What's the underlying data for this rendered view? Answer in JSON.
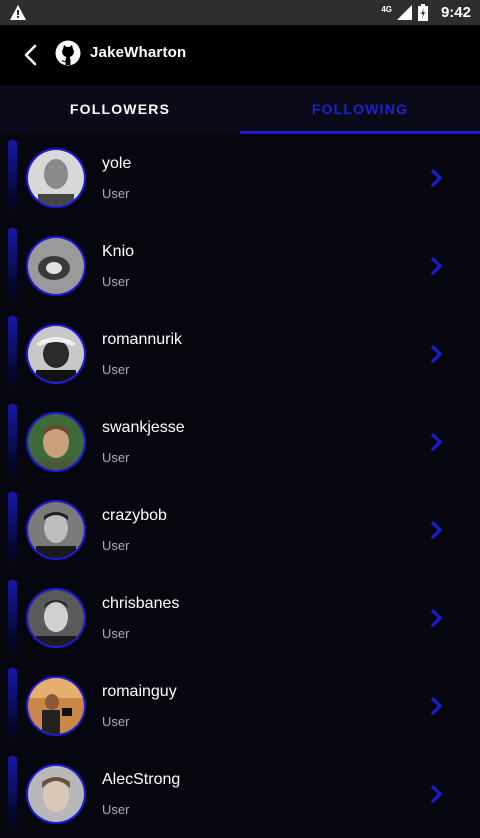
{
  "status_bar": {
    "network": "4G",
    "time": "9:42"
  },
  "toolbar": {
    "title": "JakeWharton"
  },
  "tabs": [
    {
      "label": "FOLLOWERS",
      "active": false
    },
    {
      "label": "FOLLOWING",
      "active": true
    }
  ],
  "colors": {
    "accent": "#1c1cd8",
    "background": "#06060f",
    "toolbar": "#000000"
  },
  "users": [
    {
      "name": "yole",
      "type": "User",
      "avatar_color": "#d8d8d8"
    },
    {
      "name": "Knio",
      "type": "User",
      "avatar_color": "#9a9a9a"
    },
    {
      "name": "romannurik",
      "type": "User",
      "avatar_color": "#c8c8c8"
    },
    {
      "name": "swankjesse",
      "type": "User",
      "avatar_color": "#3e6a3a"
    },
    {
      "name": "crazybob",
      "type": "User",
      "avatar_color": "#7a7a7a"
    },
    {
      "name": "chrisbanes",
      "type": "User",
      "avatar_color": "#5a5a5a"
    },
    {
      "name": "romainguy",
      "type": "User",
      "avatar_color": "#c98848"
    },
    {
      "name": "AlecStrong",
      "type": "User",
      "avatar_color": "#b8b8b8"
    }
  ]
}
